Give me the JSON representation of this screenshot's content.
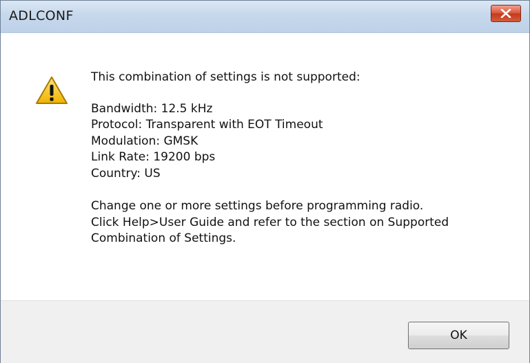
{
  "dialog": {
    "title": "ADLCONF",
    "close_icon": "close-icon",
    "warning_icon": "warning-icon",
    "headline": "This combination of settings is not supported:",
    "details": [
      "Bandwidth: 12.5 kHz",
      "Protocol: Transparent with EOT Timeout",
      "Modulation: GMSK",
      "Link Rate: 19200 bps",
      "Country: US"
    ],
    "message": [
      "Change one or more settings before programming radio.",
      "Click Help>User Guide and refer to the section on Supported",
      "Combination of Settings."
    ],
    "ok_label": "OK"
  },
  "colors": {
    "titlebar": "#c7d8ec",
    "close_button": "#c23a1c",
    "warning_fill": "#f5c518",
    "footer": "#f0f0f0"
  }
}
